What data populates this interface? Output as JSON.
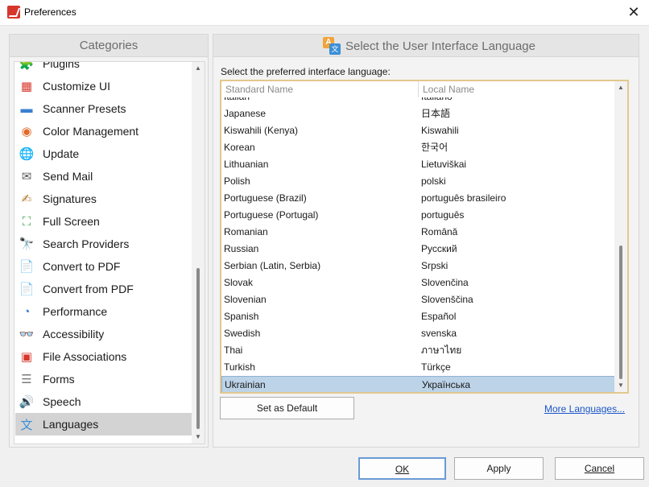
{
  "window": {
    "title": "Preferences",
    "close_glyph": "✕"
  },
  "categories": {
    "header": "Categories",
    "items": [
      {
        "label": "Plugins",
        "icon": "plugin-icon",
        "glyph": "🧩",
        "color": "#5aa34a"
      },
      {
        "label": "Customize UI",
        "icon": "customize-ui-icon",
        "glyph": "▦",
        "color": "#d6372c"
      },
      {
        "label": "Scanner Presets",
        "icon": "scanner-icon",
        "glyph": "▬",
        "color": "#3a7fd0"
      },
      {
        "label": "Color Management",
        "icon": "color-wheel-icon",
        "glyph": "◉",
        "color": "#e06a2c"
      },
      {
        "label": "Update",
        "icon": "globe-update-icon",
        "glyph": "🌐",
        "color": "#3a8fd8"
      },
      {
        "label": "Send Mail",
        "icon": "mail-icon",
        "glyph": "✉",
        "color": "#5a5a5a"
      },
      {
        "label": "Signatures",
        "icon": "signature-icon",
        "glyph": "✍",
        "color": "#b07a2a"
      },
      {
        "label": "Full Screen",
        "icon": "full-screen-icon",
        "glyph": "⛶",
        "color": "#3aa04a"
      },
      {
        "label": "Search Providers",
        "icon": "search-providers-icon",
        "glyph": "🔭",
        "color": "#3a7fd0"
      },
      {
        "label": "Convert to PDF",
        "icon": "convert-to-pdf-icon",
        "glyph": "📄",
        "color": "#d6372c"
      },
      {
        "label": "Convert from PDF",
        "icon": "convert-from-pdf-icon",
        "glyph": "📄",
        "color": "#d6372c"
      },
      {
        "label": "Performance",
        "icon": "gauge-icon",
        "glyph": "◔",
        "color": "#3a7fd0"
      },
      {
        "label": "Accessibility",
        "icon": "glasses-icon",
        "glyph": "👓",
        "color": "#4a4a4a"
      },
      {
        "label": "File Associations",
        "icon": "pdf-file-icon",
        "glyph": "▣",
        "color": "#d6372c"
      },
      {
        "label": "Forms",
        "icon": "form-icon",
        "glyph": "☰",
        "color": "#7a7a7a"
      },
      {
        "label": "Speech",
        "icon": "speaker-icon",
        "glyph": "🔊",
        "color": "#7a7a7a"
      },
      {
        "label": "Languages",
        "icon": "languages-icon",
        "glyph": "文",
        "color": "#3a8fd8",
        "selected": true
      }
    ]
  },
  "languages": {
    "header": "Select the User Interface Language",
    "prompt": "Select the preferred interface language:",
    "columns": {
      "standard": "Standard Name",
      "local": "Local Name"
    },
    "rows": [
      {
        "standard": "Italian",
        "local": "Italiano"
      },
      {
        "standard": "Japanese",
        "local": "日本語"
      },
      {
        "standard": "Kiswahili (Kenya)",
        "local": "Kiswahili"
      },
      {
        "standard": "Korean",
        "local": "한국어"
      },
      {
        "standard": "Lithuanian",
        "local": "Lietuviškai"
      },
      {
        "standard": "Polish",
        "local": "polski"
      },
      {
        "standard": "Portuguese (Brazil)",
        "local": "português brasileiro"
      },
      {
        "standard": "Portuguese (Portugal)",
        "local": "português"
      },
      {
        "standard": "Romanian",
        "local": "Română"
      },
      {
        "standard": "Russian",
        "local": "Русский"
      },
      {
        "standard": "Serbian (Latin, Serbia)",
        "local": "Srpski"
      },
      {
        "standard": "Slovak",
        "local": "Slovenčina"
      },
      {
        "standard": "Slovenian",
        "local": "Slovenščina"
      },
      {
        "standard": "Spanish",
        "local": "Español"
      },
      {
        "standard": "Swedish",
        "local": "svenska"
      },
      {
        "standard": "Thai",
        "local": "ภาษาไทย"
      },
      {
        "standard": "Turkish",
        "local": "Türkçe"
      },
      {
        "standard": "Ukrainian",
        "local": "Українська",
        "selected": true
      }
    ],
    "set_default_label": "Set as Default",
    "more_languages_label": "More Languages...",
    "icon_a": "A",
    "icon_b": "文"
  },
  "footer": {
    "ok_label": "OK",
    "apply_label": "Apply",
    "cancel_label": "Cancel"
  },
  "colors": {
    "selection": "#bcd3e8",
    "link": "#1a56c9",
    "table_border": "#e2c88e",
    "ok_border": "#6a9ad6"
  }
}
